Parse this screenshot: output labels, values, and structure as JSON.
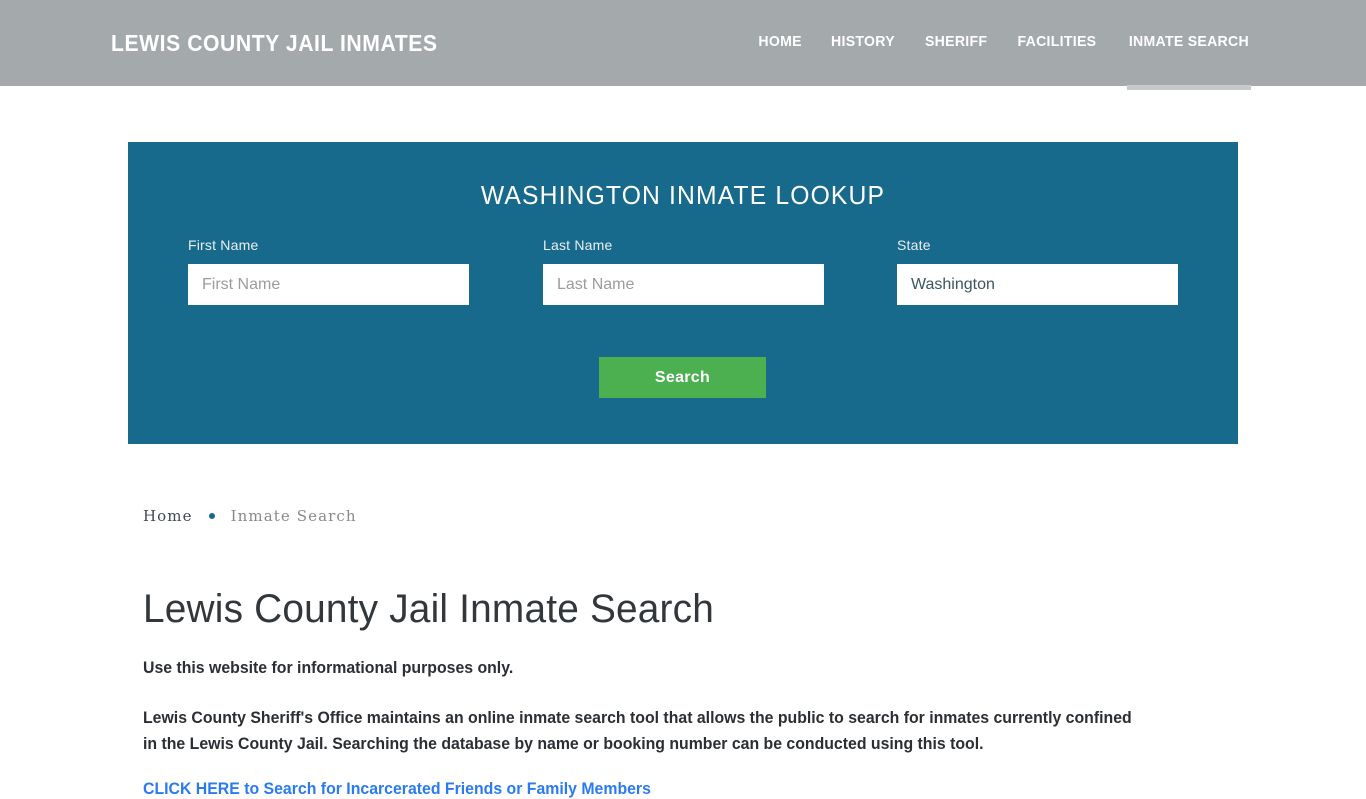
{
  "header": {
    "brand": "Lewis County Jail Inmates",
    "nav": [
      {
        "label": "Home",
        "active": false
      },
      {
        "label": "History",
        "active": false
      },
      {
        "label": "Sheriff",
        "active": false
      },
      {
        "label": "Facilities",
        "active": false
      },
      {
        "label": "Inmate Search",
        "active": true
      }
    ],
    "background_color": "#a4a9ac"
  },
  "lookup": {
    "title": "Washington Inmate Lookup",
    "panel_color": "#186a8d",
    "fields": {
      "first": {
        "label": "First Name",
        "placeholder": "First Name",
        "value": ""
      },
      "last": {
        "label": "Last Name",
        "placeholder": "Last Name",
        "value": ""
      },
      "state": {
        "label": "State",
        "placeholder": "State",
        "value": "Washington"
      }
    },
    "submit_label": "Search",
    "submit_color": "#4cb050"
  },
  "breadcrumb": {
    "home_label": "Home",
    "separator": "•",
    "current_label": "Inmate Search"
  },
  "main": {
    "title": "Lewis County Jail Inmate Search",
    "intro": "Use this website for informational purposes only.",
    "paragraph": "Lewis County Sheriff's Office maintains an online inmate search tool that allows the public to search for inmates currently confined in the Lewis County Jail. Searching the database by name or booking number can be conducted using this tool.",
    "cta_label": "CLICK HERE to Search for Incarcerated Friends or Family Members",
    "cta_color": "#2b7bf0"
  }
}
